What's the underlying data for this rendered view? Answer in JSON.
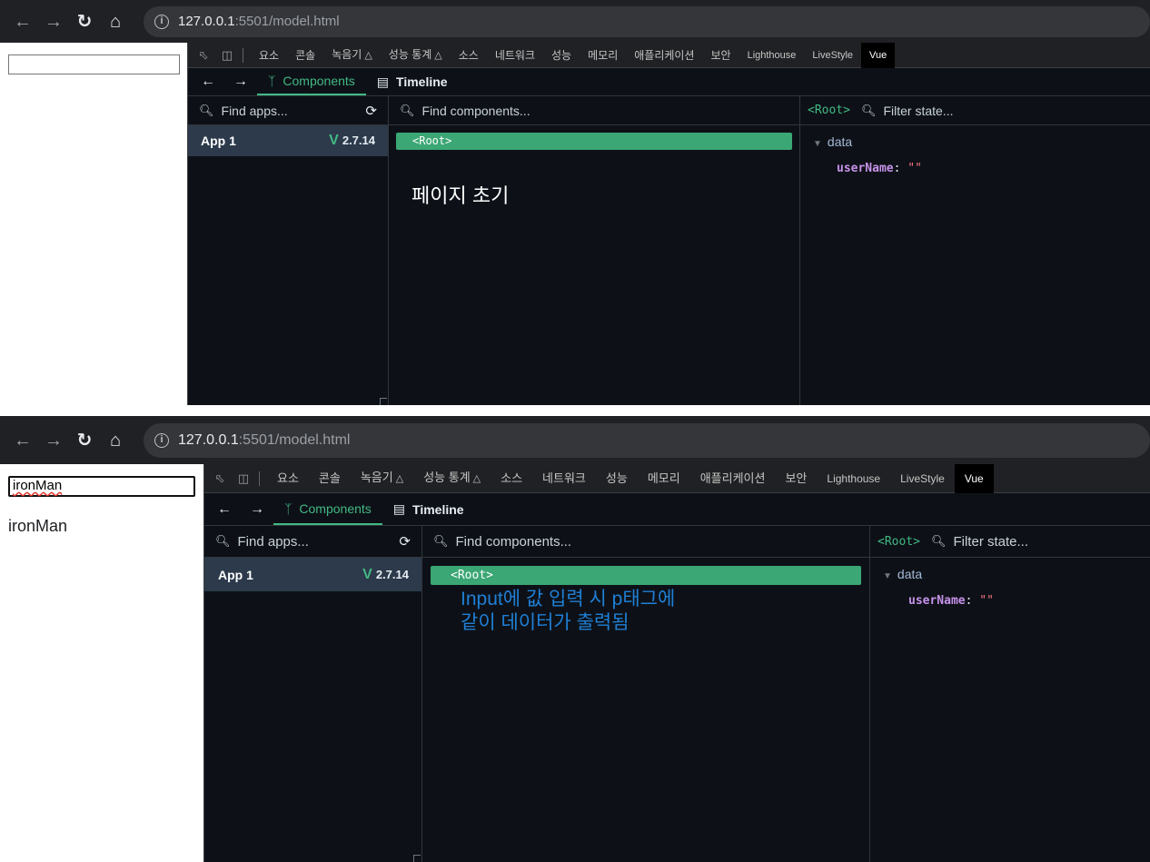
{
  "top": {
    "url_host": "127.0.0.1",
    "url_rest": ":5501/model.html",
    "input_value": "",
    "paragraph_text": "",
    "annotation": "페이지 초기",
    "user_name_value": "\"\""
  },
  "bottom": {
    "url_host": "127.0.0.1",
    "url_rest": ":5501/model.html",
    "input_value": "ironMan",
    "paragraph_text": "ironMan",
    "annotation_line1": "Input에 값 입력 시 p태그에",
    "annotation_line2": "같이 데이터가 출력됨",
    "user_name_value": "\"\""
  },
  "devtools": {
    "tabs": [
      "요소",
      "콘솔",
      "녹음기",
      "성능 통계",
      "소스",
      "네트워크",
      "성능",
      "메모리",
      "애플리케이션",
      "보안",
      "Lighthouse",
      "LiveStyle",
      "Vue"
    ],
    "active_tab": "Vue"
  },
  "vue": {
    "tab_components": "Components",
    "tab_timeline": "Timeline",
    "find_apps_placeholder": "Find apps...",
    "find_components_placeholder": "Find components...",
    "filter_state_placeholder": "Filter state...",
    "root_tag": "<Root>",
    "app_name": "App 1",
    "vue_version": "2.7.14",
    "data_section": "data",
    "prop_key": "userName",
    "prop_colon": ":"
  },
  "icons": {
    "back": "back-arrow-icon",
    "forward": "forward-arrow-icon",
    "reload": "reload-icon",
    "home": "home-icon",
    "info": "info-icon",
    "search": "search-icon",
    "refresh": "refresh-icon",
    "components": "components-icon",
    "timeline": "timeline-icon"
  },
  "colors": {
    "vue_green": "#42b883",
    "annotation_blue": "#1f7fd6",
    "devtools_bg": "#0d1117"
  }
}
